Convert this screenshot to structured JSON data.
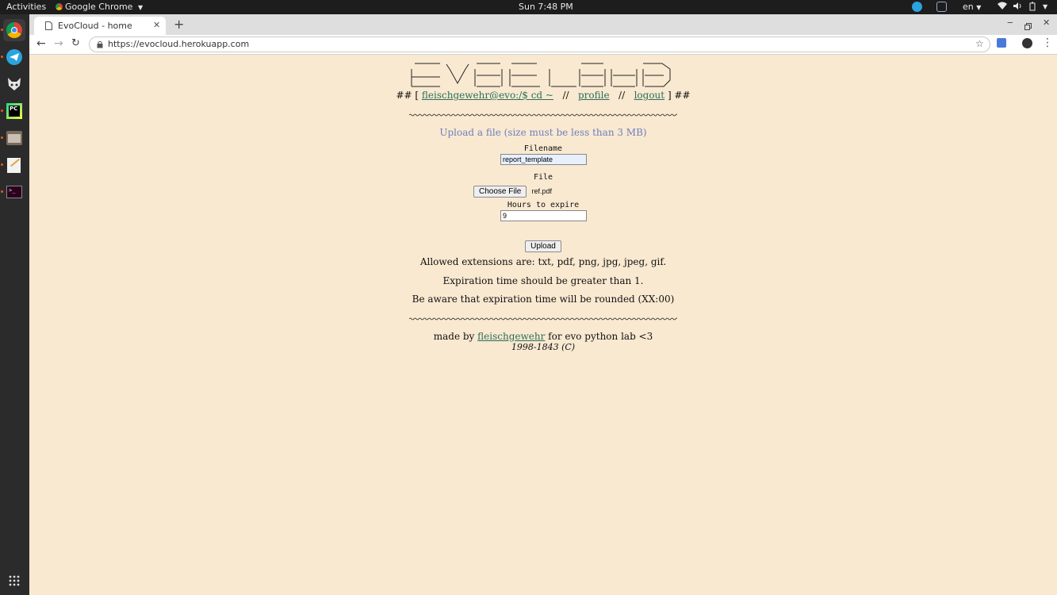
{
  "topbar": {
    "activities": "Activities",
    "app_name": "Google Chrome",
    "clock": "Sun  7:48 PM",
    "language": "en"
  },
  "dock": {
    "items": [
      "chrome-icon",
      "telegram-icon",
      "fox-icon",
      "pycharm-icon",
      "files-icon",
      "text-editor-icon",
      "terminal-icon"
    ],
    "show_apps_icon": "grid-icon"
  },
  "browser": {
    "tab_title": "EvoCloud - home",
    "url": "https://evocloud.herokuapp.com"
  },
  "header": {
    "prefix": "## [",
    "user_link": "fleischgewehr@evo:/$ cd ~",
    "sep1": "//",
    "profile_link": "profile",
    "sep2": "//",
    "logout_link": "logout",
    "suffix": "] ##"
  },
  "form": {
    "heading": "Upload a file (size must be less than 3 MB)",
    "filename_label": "Filename",
    "filename_value": "report_template",
    "file_label": "File",
    "choose_file_label": "Choose File",
    "chosen_file_name": "ref.pdf",
    "hours_label": "Hours to expire",
    "hours_value": "9",
    "upload_label": "Upload"
  },
  "notes": {
    "extensions": "Allowed extensions are: txt, pdf, png, jpg, jpeg, gif.",
    "expiration": "Expiration time should be greater than 1.",
    "rounding": "Be aware that expiration time will be rounded (XX:00)"
  },
  "footer": {
    "made_by": "made by",
    "author_link": "fleischgewehr",
    "for_text": "for evo python lab <3",
    "copyright": "1998-1843 (C)"
  },
  "colors": {
    "page_bg": "#f9e9d1",
    "link": "#2b6e5a",
    "heading": "#6f7fbf"
  }
}
